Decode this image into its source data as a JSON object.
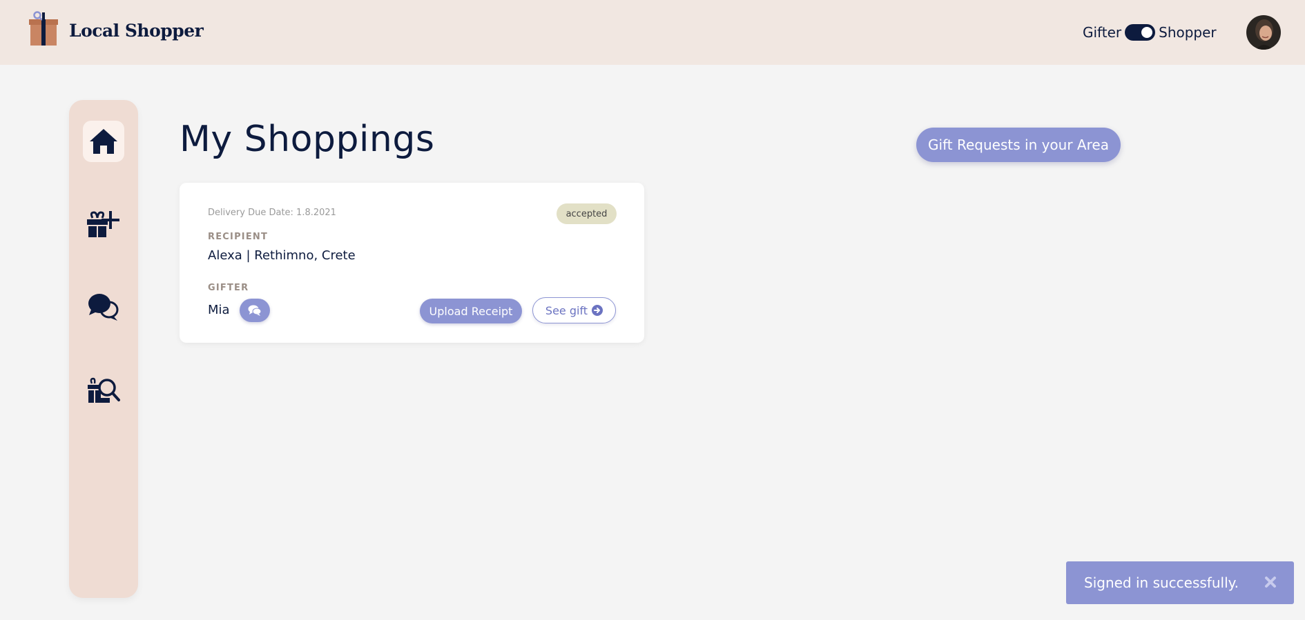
{
  "header": {
    "brand": "Local Shopper",
    "mode_left": "Gifter",
    "mode_right": "Shopper",
    "mode_selected": "Shopper"
  },
  "sidebar": {
    "items": [
      {
        "icon": "home-icon",
        "active": true
      },
      {
        "icon": "gift-add-icon",
        "active": false
      },
      {
        "icon": "chat-bubbles-icon",
        "active": false
      },
      {
        "icon": "gift-search-icon",
        "active": false
      }
    ]
  },
  "main": {
    "title": "My Shoppings",
    "area_button": "Gift Requests in your Area"
  },
  "card": {
    "due_date": "Delivery Due Date: 1.8.2021",
    "status": "accepted",
    "recipient_label": "RECIPIENT",
    "recipient": "Alexa | Rethimno, Crete",
    "gifter_label": "GIFTER",
    "gifter": "Mia",
    "upload_label": "Upload Receipt",
    "see_label": "See gift"
  },
  "toast": {
    "message": "Signed in successfully."
  },
  "colors": {
    "navy": "#0d1b3e",
    "accent": "#8c94d3",
    "header_bg": "#f1e7e1",
    "sidebar_bg": "#efdcd3",
    "badge_bg": "#e2e0c6"
  }
}
